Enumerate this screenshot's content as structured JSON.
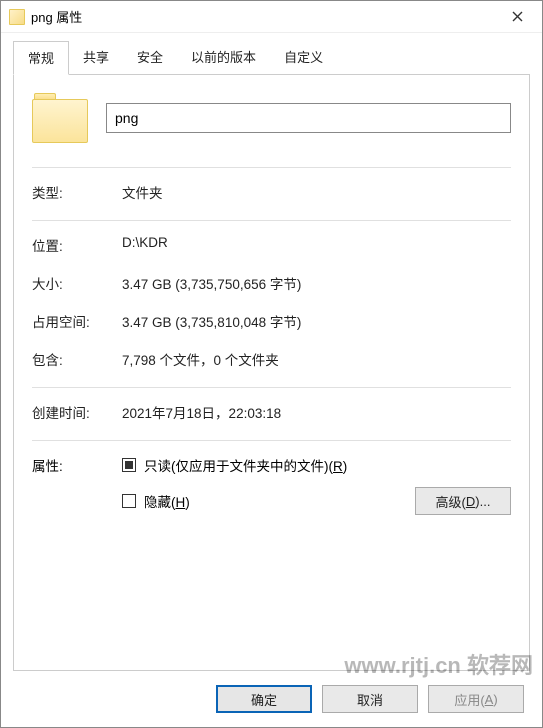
{
  "title": "png 属性",
  "tabs": {
    "general": "常规",
    "sharing": "共享",
    "security": "安全",
    "previous": "以前的版本",
    "custom": "自定义"
  },
  "name_value": "png",
  "fields": {
    "type": {
      "label": "类型:",
      "value": "文件夹"
    },
    "location": {
      "label": "位置:",
      "value": "D:\\KDR"
    },
    "size": {
      "label": "大小:",
      "value": "3.47 GB (3,735,750,656 字节)"
    },
    "size_on_disk": {
      "label": "占用空间:",
      "value": "3.47 GB (3,735,810,048 字节)"
    },
    "contains": {
      "label": "包含:",
      "value": "7,798 个文件，0 个文件夹"
    },
    "created": {
      "label": "创建时间:",
      "value": "2021年7月18日，22:03:18"
    }
  },
  "attributes": {
    "label": "属性:",
    "readonly_prefix": "只读(仅应用于文件夹中的文件)(",
    "readonly_key": "R",
    "readonly_suffix": ")",
    "hidden_prefix": "隐藏(",
    "hidden_key": "H",
    "hidden_suffix": ")",
    "advanced_prefix": "高级(",
    "advanced_key": "D",
    "advanced_suffix": ")..."
  },
  "buttons": {
    "ok": "确定",
    "cancel": "取消",
    "apply_prefix": "应用(",
    "apply_key": "A",
    "apply_suffix": ")"
  },
  "watermark": "www.rjtj.cn 软荐网"
}
